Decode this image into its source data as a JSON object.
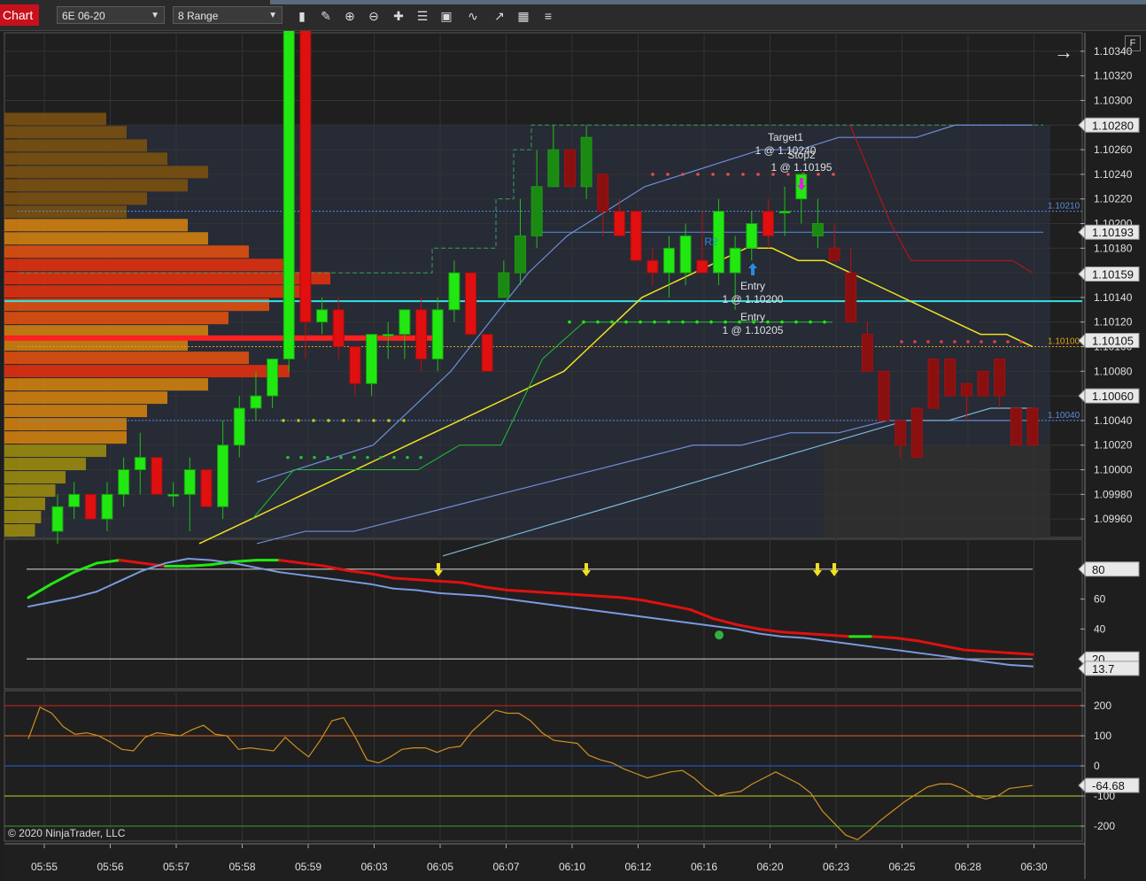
{
  "toolbar": {
    "brand": "Chart",
    "instrument": "6E 06-20",
    "period": "8 Range",
    "tools": [
      "bars-type-icon",
      "pencil-icon",
      "zoom-in-icon",
      "zoom-out-icon",
      "crosshair-icon",
      "properties-icon",
      "data-box-icon",
      "indicators-icon",
      "strategies-icon",
      "templates-icon"
    ]
  },
  "copyright": "© 2020 NinjaTrader, LLC",
  "top_right": {
    "fixed_label": "F",
    "arrow": "→"
  },
  "colors": {
    "up": "#22e812",
    "down": "#e01010",
    "grid": "#333333",
    "bg": "#1e1e1e",
    "cyan": "#39e0e8",
    "yellow": "#f0e020"
  },
  "chart_data": [
    {
      "type": "candlestick",
      "title": "",
      "ylim": [
        1.09945,
        1.10355
      ],
      "y_ticks": [
        1.1034,
        1.1032,
        1.103,
        1.1028,
        1.1026,
        1.1024,
        1.1022,
        1.102,
        1.1018,
        1.1016,
        1.1014,
        1.1012,
        1.101,
        1.1008,
        1.1006,
        1.1004,
        1.1002,
        1.1,
        1.0998,
        1.0996
      ],
      "y_tick_labels": [
        "1.10340",
        "1.10320",
        "1.10300",
        "1.10280",
        "1.10260",
        "1.10240",
        "1.10220",
        "1.10200",
        "1.10180",
        "1.10160",
        "1.10140",
        "1.10120",
        "1.10100",
        "1.10080",
        "1.10060",
        "1.10040",
        "1.10020",
        "1.10000",
        "1.09980",
        "1.09960"
      ],
      "x_tick_labels": [
        "05:55",
        "05:56",
        "05:57",
        "05:58",
        "05:59",
        "06:03",
        "06:05",
        "06:07",
        "06:10",
        "06:12",
        "06:16",
        "06:20",
        "06:23",
        "06:25",
        "06:28",
        "06:30"
      ],
      "price_markers": [
        {
          "value": 1.1028,
          "label": "1.10280"
        },
        {
          "value": 1.10193,
          "label": "1.10193"
        },
        {
          "value": 1.10159,
          "label": "1.10159"
        },
        {
          "value": 1.10105,
          "label": "1.10105"
        },
        {
          "value": 1.1006,
          "label": "1.10060"
        }
      ],
      "level_lines": [
        {
          "value": 1.1021,
          "label": "1.10210",
          "color": "#5b8de0"
        },
        {
          "value": 1.101,
          "label": "1.10100",
          "color": "#d9a020"
        },
        {
          "value": 1.1004,
          "label": "1.10040",
          "color": "#5b8de0"
        }
      ],
      "candles": [
        [
          1.0995,
          1.0998,
          1.0994,
          1.0997
        ],
        [
          1.0997,
          1.0999,
          1.0996,
          1.0998
        ],
        [
          1.0998,
          1.0997,
          1.0996,
          1.0996
        ],
        [
          1.0996,
          1.0999,
          1.0995,
          1.0998
        ],
        [
          1.0998,
          1.1001,
          1.0997,
          1.1
        ],
        [
          1.1,
          1.1003,
          1.0998,
          1.1001
        ],
        [
          1.1001,
          1.1,
          1.0998,
          1.0998
        ],
        [
          1.0998,
          1.0999,
          1.0997,
          1.0998
        ],
        [
          1.0998,
          1.1001,
          1.0995,
          1.1
        ],
        [
          1.1,
          1.0998,
          1.0997,
          1.0997
        ],
        [
          1.0997,
          1.1004,
          1.0996,
          1.1002
        ],
        [
          1.1002,
          1.1006,
          1.1001,
          1.1005
        ],
        [
          1.1005,
          1.1008,
          1.1004,
          1.1006
        ],
        [
          1.1006,
          1.1009,
          1.1005,
          1.1009
        ],
        [
          1.1009,
          1.1012,
          1.1008,
          1.111
        ],
        [
          1.111,
          1.1013,
          1.1009,
          1.1012
        ],
        [
          1.1012,
          1.1014,
          1.1011,
          1.1013
        ],
        [
          1.1013,
          1.1014,
          1.1009,
          1.101
        ],
        [
          1.101,
          1.1007,
          1.1006,
          1.1007
        ],
        [
          1.1007,
          1.1011,
          1.1006,
          1.1011
        ],
        [
          1.1011,
          1.1012,
          1.1009,
          1.1011
        ],
        [
          1.1011,
          1.1013,
          1.1009,
          1.1013
        ],
        [
          1.1013,
          1.1014,
          1.1008,
          1.1009
        ],
        [
          1.1009,
          1.1014,
          1.1008,
          1.1013
        ],
        [
          1.1013,
          1.1017,
          1.1012,
          1.1016
        ],
        [
          1.1016,
          1.1015,
          1.1011,
          1.1011
        ],
        [
          1.1011,
          1.1009,
          1.1008,
          1.1008
        ],
        [
          1.1014,
          1.1017,
          1.1014,
          1.1016
        ],
        [
          1.1016,
          1.1022,
          1.1015,
          1.1019
        ],
        [
          1.1019,
          1.1026,
          1.1018,
          1.1023
        ],
        [
          1.1023,
          1.1028,
          1.1023,
          1.1026
        ],
        [
          1.1026,
          1.1025,
          1.1023,
          1.1023
        ],
        [
          1.1023,
          1.1028,
          1.1022,
          1.1027
        ],
        [
          1.1024,
          1.1023,
          1.1019,
          1.1021
        ],
        [
          1.1021,
          1.1022,
          1.1019,
          1.1019
        ],
        [
          1.1021,
          1.1021,
          1.1017,
          1.1017
        ],
        [
          1.1017,
          1.1018,
          1.1015,
          1.1016
        ],
        [
          1.1016,
          1.1019,
          1.1014,
          1.1018
        ],
        [
          1.1016,
          1.102,
          1.1015,
          1.1019
        ],
        [
          1.1017,
          1.1021,
          1.1016,
          1.1016
        ],
        [
          1.1016,
          1.1022,
          1.1015,
          1.1021
        ],
        [
          1.1016,
          1.1019,
          1.1013,
          1.1018
        ],
        [
          1.1018,
          1.1021,
          1.1017,
          1.102
        ],
        [
          1.1021,
          1.1022,
          1.1018,
          1.1019
        ],
        [
          1.1021,
          1.1023,
          1.1019,
          1.1021
        ],
        [
          1.1022,
          1.1024,
          1.102,
          1.1024
        ],
        [
          1.1019,
          1.1022,
          1.1018,
          1.102
        ],
        [
          1.1018,
          1.102,
          1.1017,
          1.1017
        ],
        [
          1.1016,
          1.1018,
          1.1012,
          1.1012
        ],
        [
          1.1011,
          1.1012,
          1.1008,
          1.1008
        ],
        [
          1.1008,
          1.1005,
          1.1004,
          1.1004
        ],
        [
          1.1004,
          1.1002,
          1.1001,
          1.1002
        ],
        [
          1.1005,
          1.1005,
          1.1001,
          1.1001
        ],
        [
          1.1009,
          1.1005,
          1.1005,
          1.1005
        ],
        [
          1.1009,
          1.1008,
          1.1006,
          1.1006
        ],
        [
          1.1007,
          1.1006,
          1.1004,
          1.1006
        ],
        [
          1.1008,
          1.1008,
          1.1006,
          1.1006
        ],
        [
          1.1009,
          1.1006,
          1.1005,
          1.1006
        ],
        [
          1.1005,
          1.1004,
          1.1002,
          1.1002
        ],
        [
          1.1005,
          1.1005,
          1.1002,
          1.1002
        ]
      ],
      "ema_yellow": [
        1.0994,
        1.0995,
        1.0996,
        1.0997,
        1.0998,
        1.0999,
        1.1,
        1.1001,
        1.1002,
        1.1003,
        1.1004,
        1.1005,
        1.1006,
        1.1007,
        1.1008,
        1.101,
        1.1012,
        1.1014,
        1.1015,
        1.1016,
        1.1017,
        1.1018,
        1.1018,
        1.1017,
        1.1017,
        1.1016,
        1.1015,
        1.1014,
        1.1013,
        1.1012,
        1.1011,
        1.1011,
        1.101
      ],
      "band_upper": [
        1.0999,
        1.1,
        1.1001,
        1.1002,
        1.1005,
        1.1008,
        1.1012,
        1.1016,
        1.1019,
        1.1021,
        1.1023,
        1.1024,
        1.1025,
        1.1026,
        1.1026,
        1.1027,
        1.1027,
        1.1027,
        1.1028,
        1.1028,
        1.1028
      ],
      "band_lower": [
        1.0994,
        1.0995,
        1.0995,
        1.0996,
        1.0997,
        1.0998,
        1.0999,
        1.1,
        1.1001,
        1.1002,
        1.1002,
        1.1003,
        1.1003,
        1.1004,
        1.1004,
        1.1004,
        1.1004
      ],
      "band_mid": [
        1.0993,
        1.0994,
        1.0995,
        1.0996,
        1.0997,
        1.0998,
        1.0999,
        1.1,
        1.1001,
        1.1002,
        1.1003,
        1.1004,
        1.1004,
        1.1005,
        1.1005
      ],
      "stop_green": [
        1.0996,
        1.1,
        1.1,
        1.1,
        1.1,
        1.1002,
        1.1002,
        1.1009,
        1.1012,
        1.1012,
        1.1012,
        1.1012,
        1.1012,
        1.1012,
        1.1012
      ],
      "stop_red": [
        1.1028,
        1.1024,
        1.102,
        1.1017,
        1.1017,
        1.1017,
        1.1017,
        1.1017,
        1.1017,
        1.1016
      ],
      "orders": [
        {
          "label": "Target1",
          "detail": "1 @ 1.10240"
        },
        {
          "label": "Stop2",
          "detail": "1 @ 1.10195"
        },
        {
          "label": "Entry",
          "detail": "1 @ 1.10200"
        },
        {
          "label": "Entry",
          "detail": "1 @ 1.10205"
        },
        {
          "label": "R2",
          "detail": ""
        }
      ],
      "volume_profile": [
        0.5,
        0.6,
        0.7,
        0.8,
        1.0,
        0.9,
        0.7,
        0.6,
        0.9,
        1.0,
        1.2,
        1.4,
        1.6,
        1.5,
        1.3,
        1.1,
        1.0,
        0.9,
        1.2,
        1.4,
        1.0,
        0.8,
        0.7,
        0.6,
        0.6,
        0.5,
        0.4,
        0.3,
        0.25,
        0.2,
        0.18,
        0.15
      ]
    },
    {
      "type": "line",
      "title": "",
      "ylim": [
        0,
        100
      ],
      "y_ticks": [
        80,
        60,
        40,
        20
      ],
      "y_tick_labels": [
        "80",
        "60",
        "40",
        "20"
      ],
      "markers": [
        {
          "value": 80,
          "label": "80"
        },
        {
          "value": 20,
          "label": "20"
        },
        {
          "value": 13.7,
          "label": "13.7"
        }
      ],
      "series": [
        {
          "values": [
            61,
            70,
            78,
            84,
            86,
            84,
            82,
            82,
            83,
            85,
            86,
            86,
            84,
            82,
            79,
            77,
            74,
            73,
            72,
            71,
            68,
            66,
            65,
            64,
            63,
            62,
            61,
            59,
            56,
            53,
            47,
            43,
            40,
            38,
            37,
            36,
            35,
            35,
            34,
            32,
            29,
            26,
            25,
            24,
            23
          ]
        },
        {
          "values": [
            55,
            58,
            61,
            65,
            72,
            79,
            84,
            87,
            86,
            84,
            81,
            78,
            76,
            74,
            72,
            70,
            67,
            66,
            64,
            63,
            62,
            60,
            58,
            56,
            54,
            52,
            50,
            48,
            46,
            44,
            42,
            40,
            37,
            35,
            34,
            32,
            30,
            28,
            26,
            24,
            22,
            20,
            18,
            16,
            15
          ]
        }
      ]
    },
    {
      "type": "line",
      "title": "",
      "ylim": [
        -250,
        250
      ],
      "y_ticks": [
        200,
        100,
        0,
        -100,
        -200
      ],
      "y_tick_labels": [
        "200",
        "100",
        "0",
        "-100",
        "-200"
      ],
      "markers": [
        {
          "value": -64.68,
          "label": "-64.68"
        }
      ],
      "series": [
        {
          "values": [
            90,
            195,
            175,
            130,
            105,
            110,
            100,
            80,
            55,
            50,
            95,
            110,
            105,
            100,
            120,
            135,
            105,
            100,
            55,
            60,
            55,
            50,
            95,
            60,
            30,
            85,
            150,
            160,
            95,
            20,
            10,
            30,
            55,
            60,
            60,
            45,
            60,
            65,
            115,
            150,
            185,
            175,
            175,
            150,
            110,
            85,
            80,
            75,
            35,
            20,
            10,
            -10,
            -25,
            -40,
            -30,
            -20,
            -15,
            -40,
            -75,
            -100,
            -90,
            -85,
            -60,
            -40,
            -20,
            -40,
            -60,
            -90,
            -150,
            -190,
            -230,
            -245,
            -215,
            -180,
            -150,
            -120,
            -95,
            -70,
            -60,
            -60,
            -75,
            -100,
            -110,
            -100,
            -75,
            -70,
            -65
          ]
        }
      ]
    }
  ]
}
